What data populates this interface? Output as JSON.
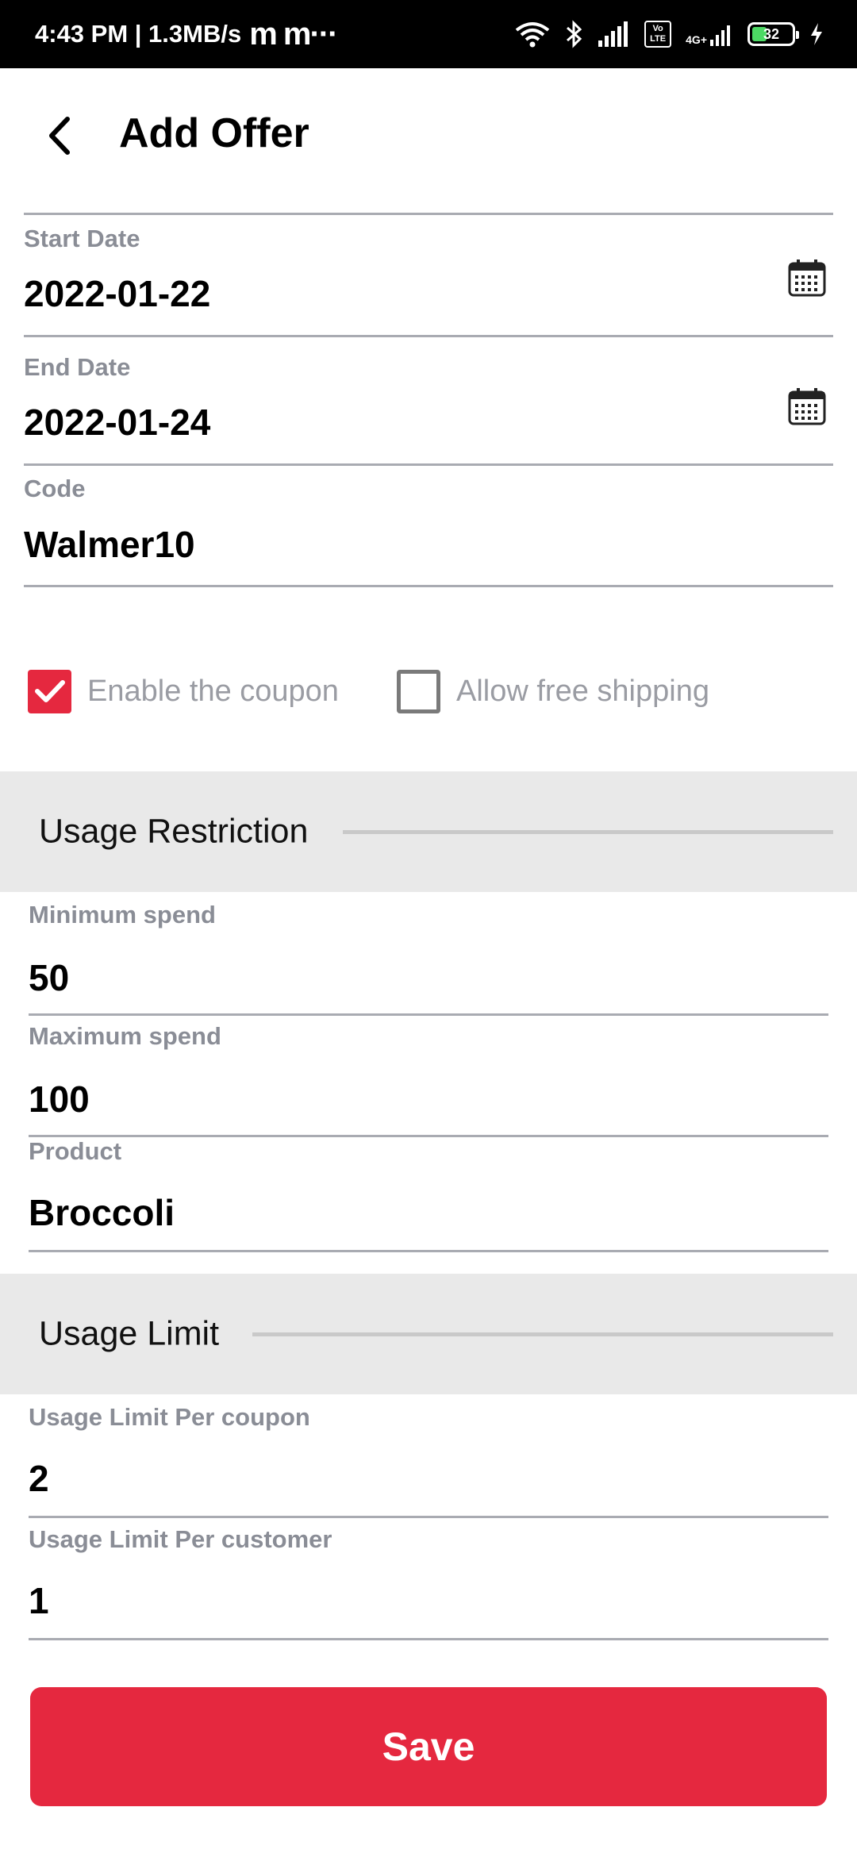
{
  "status_bar": {
    "time_info": "4:43 PM | 1.3MB/s",
    "app_icons": "m  m···",
    "volte_label": "Vo LTE",
    "network_label": "4G+",
    "battery_level": "32"
  },
  "header": {
    "back_icon": "chevron-left-icon",
    "title": "Add Offer"
  },
  "form": {
    "start_date": {
      "label": "Start Date",
      "value": "2022-01-22",
      "icon": "calendar-icon"
    },
    "end_date": {
      "label": "End Date",
      "value": "2022-01-24",
      "icon": "calendar-icon"
    },
    "code": {
      "label": "Code",
      "value": "Walmer10"
    },
    "enable_coupon": {
      "label": "Enable the coupon",
      "checked": true
    },
    "free_shipping": {
      "label": "Allow free shipping",
      "checked": false
    }
  },
  "usage_restriction": {
    "title": "Usage Restriction",
    "minimum_spend": {
      "label": "Minimum spend",
      "value": "50"
    },
    "maximum_spend": {
      "label": "Maximum spend",
      "value": "100"
    },
    "product": {
      "label": "Product",
      "value": "Broccoli"
    }
  },
  "usage_limit": {
    "title": "Usage Limit",
    "per_coupon": {
      "label": "Usage Limit Per coupon",
      "value": "2"
    },
    "per_customer": {
      "label": "Usage Limit Per customer",
      "value": "1"
    }
  },
  "actions": {
    "save_label": "Save"
  },
  "colors": {
    "accent": "#e5283f",
    "label_gray": "#8a8d96",
    "band_gray": "#e9e9e9"
  }
}
